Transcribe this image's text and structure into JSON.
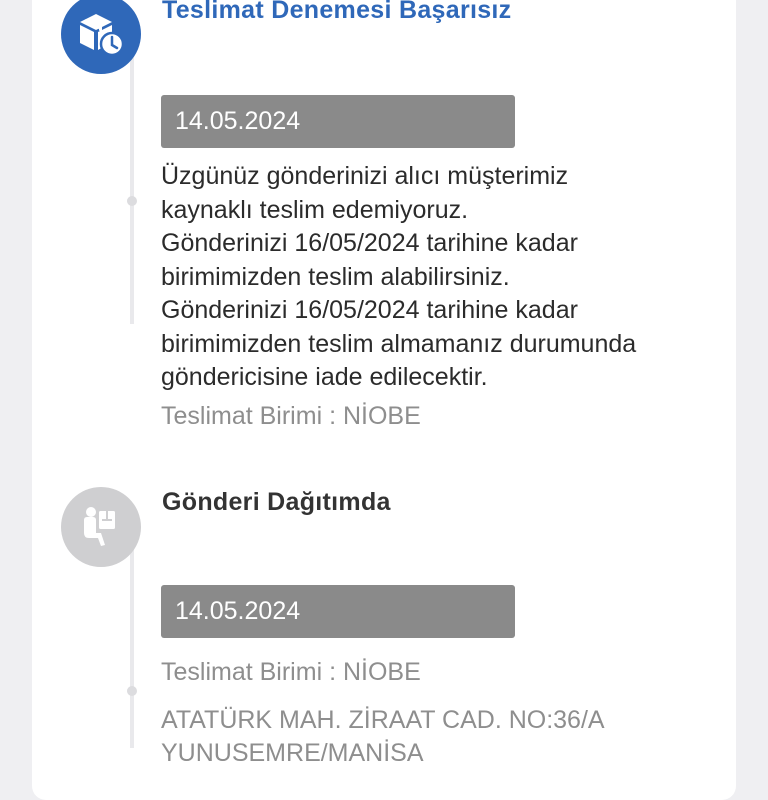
{
  "events": [
    {
      "title": "Teslimat Denemesi Başarısız",
      "status": "active",
      "icon": "delivery-clock-icon",
      "date": "14.05.2024",
      "message_lines": [
        "Üzgünüz gönderinizi alıcı müşterimiz",
        "kaynaklı teslim edemiyoruz.",
        "Gönderinizi 16/05/2024 tarihine kadar",
        "birimimizden teslim alabilirsiniz.",
        "Gönderinizi 16/05/2024 tarihine kadar",
        "birimimizden teslim almamanız durumunda",
        "göndericisine iade edilecektir."
      ],
      "unit": "Teslimat Birimi : NİOBE"
    },
    {
      "title": "Gönderi Dağıtımda",
      "status": "inactive",
      "icon": "courier-package-icon",
      "date": "14.05.2024",
      "unit": "Teslimat Birimi : NİOBE",
      "address_lines": [
        "ATATÜRK MAH. ZİRAAT CAD. NO:36/A",
        "YUNUSEMRE/MANİSA"
      ]
    }
  ],
  "colors": {
    "active": "#2f68b9",
    "inactive": "#cfcfd1",
    "date_box": "#8a8a8a",
    "meta_text": "#8e8e8e"
  }
}
